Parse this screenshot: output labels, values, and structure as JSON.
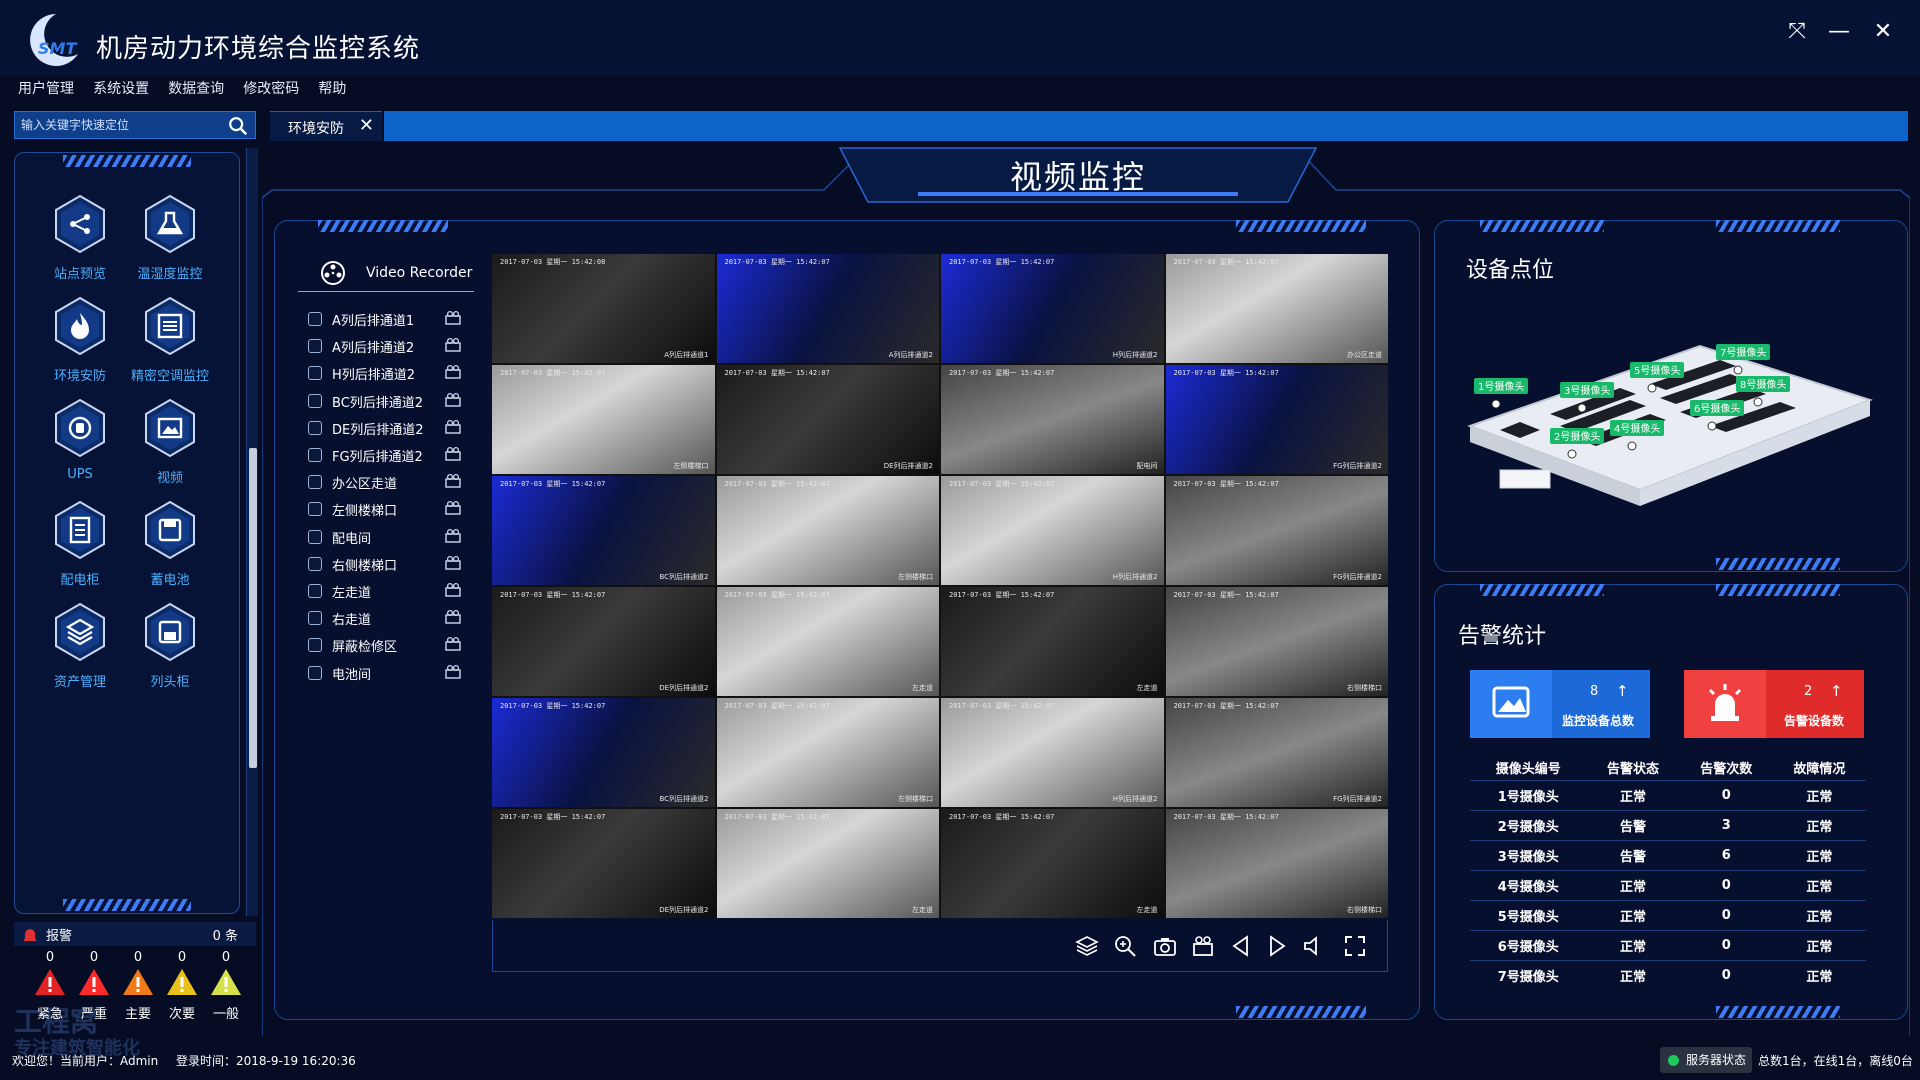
{
  "app": {
    "title": "机房动力环境综合监控系统",
    "logo_text": "SMT"
  },
  "window": {
    "restore_symbol": "⤧",
    "minimize_symbol": "—",
    "close_symbol": "✕"
  },
  "menu": [
    "用户管理",
    "系统设置",
    "数据查询",
    "修改密码",
    "帮助"
  ],
  "search": {
    "placeholder": "输入关键字快速定位"
  },
  "tabs": [
    {
      "label": "环境安防",
      "close": "✕"
    }
  ],
  "sidebar": {
    "items": [
      {
        "label": "站点预览",
        "icon": "share-icon"
      },
      {
        "label": "温湿度监控",
        "icon": "flask-icon"
      },
      {
        "label": "环境安防",
        "icon": "fire-icon"
      },
      {
        "label": "精密空调监控",
        "icon": "aircon-icon"
      },
      {
        "label": "UPS",
        "icon": "ups-icon"
      },
      {
        "label": "视频",
        "icon": "video-icon"
      },
      {
        "label": "配电柜",
        "icon": "cabinet-icon"
      },
      {
        "label": "蓄电池",
        "icon": "battery-icon"
      },
      {
        "label": "资产管理",
        "icon": "layers-icon"
      },
      {
        "label": "列头柜",
        "icon": "save-icon"
      }
    ]
  },
  "alarm_panel": {
    "title": "报警",
    "count": "0 条",
    "levels": [
      {
        "label": "紧急",
        "count": "0",
        "color": "#e02424"
      },
      {
        "label": "严重",
        "count": "0",
        "color": "#ff2a2a"
      },
      {
        "label": "主要",
        "count": "0",
        "color": "#f07a1a"
      },
      {
        "label": "次要",
        "count": "0",
        "color": "#e8c21a"
      },
      {
        "label": "一般",
        "count": "0",
        "color": "#d6e04a"
      }
    ]
  },
  "main": {
    "page_title": "视频监控",
    "recorder_label": "Video Recorder",
    "cameras": [
      "A列后排通道1",
      "A列后排通道2",
      "H列后排通道2",
      "BC列后排通道2",
      "DE列后排通道2",
      "FG列后排通道2",
      "办公区走道",
      "左侧楼梯口",
      "配电间",
      "右侧楼梯口",
      "左走道",
      "右走道",
      "屏蔽检修区",
      "电池间"
    ],
    "video_feeds": [
      {
        "ts": "2017-07-03 星期一 15:42:08",
        "name": "A列后排通道1",
        "tone": "dark"
      },
      {
        "ts": "2017-07-03 星期一 15:42:07",
        "name": "A列后排通道2",
        "tone": "blue"
      },
      {
        "ts": "2017-07-03 星期一 15:42:07",
        "name": "H列后排通道2",
        "tone": "blue"
      },
      {
        "ts": "2017-07-03 星期一 15:42:07",
        "name": "办公区走道",
        "tone": "light"
      },
      {
        "ts": "2017-07-03 星期一 15:42:07",
        "name": "左侧楼梯口",
        "tone": "light"
      },
      {
        "ts": "2017-07-03 星期一 15:42:07",
        "name": "DE列后排通道2",
        "tone": "dark"
      },
      {
        "ts": "2017-07-03 星期一 15:42:07",
        "name": "配电间",
        "tone": "mid"
      },
      {
        "ts": "2017-07-03 星期一 15:42:07",
        "name": "FG列后排通道2",
        "tone": "blue"
      },
      {
        "ts": "2017-07-03 星期一 15:42:07",
        "name": "BC列后排通道2",
        "tone": "blue"
      },
      {
        "ts": "2017-07-03 星期一 15:42:07",
        "name": "左侧楼梯口",
        "tone": "light"
      },
      {
        "ts": "2017-07-03 星期一 15:42:07",
        "name": "H列后排通道2",
        "tone": "light"
      },
      {
        "ts": "2017-07-03 星期一 15:42:07",
        "name": "FG列后排通道2",
        "tone": "mid"
      },
      {
        "ts": "2017-07-03 星期一 15:42:07",
        "name": "DE列后排通道2",
        "tone": "dark"
      },
      {
        "ts": "2017-07-03 星期一 15:42:07",
        "name": "左走道",
        "tone": "light"
      },
      {
        "ts": "2017-07-03 星期一 15:42:07",
        "name": "左走道",
        "tone": "dark"
      },
      {
        "ts": "2017-07-03 星期一 15:42:07",
        "name": "右侧楼梯口",
        "tone": "mid"
      },
      {
        "ts": "2017-07-03 星期一 15:42:07",
        "name": "BC列后排通道2",
        "tone": "blue"
      },
      {
        "ts": "2017-07-03 星期一 15:42:07",
        "name": "左侧楼梯口",
        "tone": "light"
      },
      {
        "ts": "2017-07-03 星期一 15:42:07",
        "name": "H列后排通道2",
        "tone": "light"
      },
      {
        "ts": "2017-07-03 星期一 15:42:07",
        "name": "FG列后排通道2",
        "tone": "mid"
      },
      {
        "ts": "2017-07-03 星期一 15:42:07",
        "name": "DE列后排通道2",
        "tone": "dark"
      },
      {
        "ts": "2017-07-03 星期一 15:42:07",
        "name": "左走道",
        "tone": "light"
      },
      {
        "ts": "2017-07-03 星期一 15:42:07",
        "name": "左走道",
        "tone": "dark"
      },
      {
        "ts": "2017-07-03 星期一 15:42:07",
        "name": "右侧楼梯口",
        "tone": "mid"
      }
    ],
    "toolbar_icons": [
      "layers-icon",
      "zoom-in-icon",
      "camera-icon",
      "record-icon",
      "prev-icon",
      "play-icon",
      "volume-icon",
      "fullscreen-icon"
    ]
  },
  "device_panel": {
    "title": "设备点位",
    "cameras": [
      "1号摄像头",
      "2号摄像头",
      "3号摄像头",
      "4号摄像头",
      "5号摄像头",
      "6号摄像头",
      "7号摄像头",
      "8号摄像头"
    ]
  },
  "alarm_stats": {
    "title": "告警统计",
    "total": {
      "value": "8",
      "arrow": "↑",
      "label": "监控设备总数",
      "color": "#1d69d8"
    },
    "alarm": {
      "value": "2",
      "arrow": "↑",
      "label": "告警设备数",
      "color": "#e02b2b"
    },
    "table": {
      "headers": [
        "摄像头编号",
        "告警状态",
        "告警次数",
        "故障情况"
      ],
      "rows": [
        [
          "1号摄像头",
          "正常",
          "0",
          "正常"
        ],
        [
          "2号摄像头",
          "告警",
          "3",
          "正常"
        ],
        [
          "3号摄像头",
          "告警",
          "6",
          "正常"
        ],
        [
          "4号摄像头",
          "正常",
          "0",
          "正常"
        ],
        [
          "5号摄像头",
          "正常",
          "0",
          "正常"
        ],
        [
          "6号摄像头",
          "正常",
          "0",
          "正常"
        ],
        [
          "7号摄像头",
          "正常",
          "0",
          "正常"
        ]
      ]
    }
  },
  "status": {
    "welcome": "欢迎您！当前用户：Admin",
    "login_time": "登录时间：2018-9-19  16:20:36",
    "server_status": "服务器状态",
    "summary": "总数1台，在线1台，离线0台",
    "watermark_line1": "工程窝",
    "watermark_line2": "专注建筑智能化"
  }
}
